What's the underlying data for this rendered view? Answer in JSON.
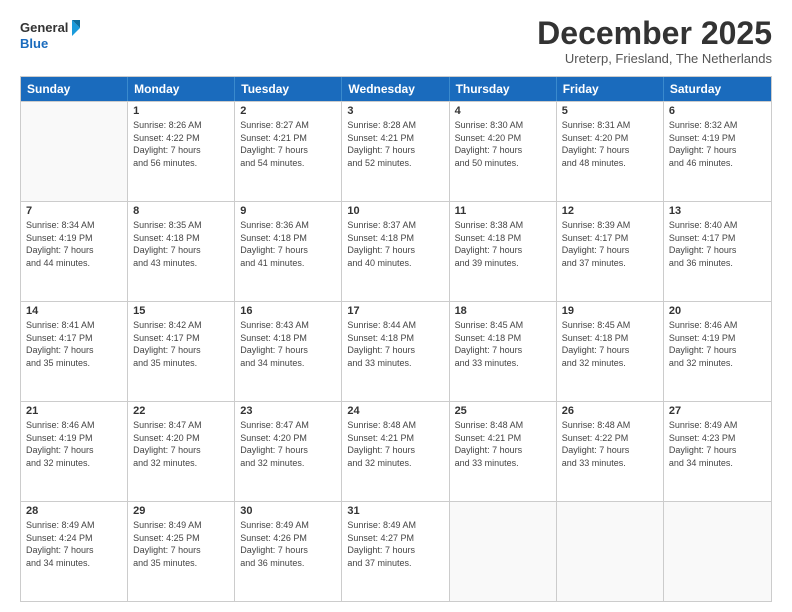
{
  "logo": {
    "line1": "General",
    "line2": "Blue"
  },
  "title": "December 2025",
  "subtitle": "Ureterp, Friesland, The Netherlands",
  "days_of_week": [
    "Sunday",
    "Monday",
    "Tuesday",
    "Wednesday",
    "Thursday",
    "Friday",
    "Saturday"
  ],
  "weeks": [
    [
      {
        "day": "",
        "info": ""
      },
      {
        "day": "1",
        "info": "Sunrise: 8:26 AM\nSunset: 4:22 PM\nDaylight: 7 hours\nand 56 minutes."
      },
      {
        "day": "2",
        "info": "Sunrise: 8:27 AM\nSunset: 4:21 PM\nDaylight: 7 hours\nand 54 minutes."
      },
      {
        "day": "3",
        "info": "Sunrise: 8:28 AM\nSunset: 4:21 PM\nDaylight: 7 hours\nand 52 minutes."
      },
      {
        "day": "4",
        "info": "Sunrise: 8:30 AM\nSunset: 4:20 PM\nDaylight: 7 hours\nand 50 minutes."
      },
      {
        "day": "5",
        "info": "Sunrise: 8:31 AM\nSunset: 4:20 PM\nDaylight: 7 hours\nand 48 minutes."
      },
      {
        "day": "6",
        "info": "Sunrise: 8:32 AM\nSunset: 4:19 PM\nDaylight: 7 hours\nand 46 minutes."
      }
    ],
    [
      {
        "day": "7",
        "info": "Sunrise: 8:34 AM\nSunset: 4:19 PM\nDaylight: 7 hours\nand 44 minutes."
      },
      {
        "day": "8",
        "info": "Sunrise: 8:35 AM\nSunset: 4:18 PM\nDaylight: 7 hours\nand 43 minutes."
      },
      {
        "day": "9",
        "info": "Sunrise: 8:36 AM\nSunset: 4:18 PM\nDaylight: 7 hours\nand 41 minutes."
      },
      {
        "day": "10",
        "info": "Sunrise: 8:37 AM\nSunset: 4:18 PM\nDaylight: 7 hours\nand 40 minutes."
      },
      {
        "day": "11",
        "info": "Sunrise: 8:38 AM\nSunset: 4:18 PM\nDaylight: 7 hours\nand 39 minutes."
      },
      {
        "day": "12",
        "info": "Sunrise: 8:39 AM\nSunset: 4:17 PM\nDaylight: 7 hours\nand 37 minutes."
      },
      {
        "day": "13",
        "info": "Sunrise: 8:40 AM\nSunset: 4:17 PM\nDaylight: 7 hours\nand 36 minutes."
      }
    ],
    [
      {
        "day": "14",
        "info": "Sunrise: 8:41 AM\nSunset: 4:17 PM\nDaylight: 7 hours\nand 35 minutes."
      },
      {
        "day": "15",
        "info": "Sunrise: 8:42 AM\nSunset: 4:17 PM\nDaylight: 7 hours\nand 35 minutes."
      },
      {
        "day": "16",
        "info": "Sunrise: 8:43 AM\nSunset: 4:18 PM\nDaylight: 7 hours\nand 34 minutes."
      },
      {
        "day": "17",
        "info": "Sunrise: 8:44 AM\nSunset: 4:18 PM\nDaylight: 7 hours\nand 33 minutes."
      },
      {
        "day": "18",
        "info": "Sunrise: 8:45 AM\nSunset: 4:18 PM\nDaylight: 7 hours\nand 33 minutes."
      },
      {
        "day": "19",
        "info": "Sunrise: 8:45 AM\nSunset: 4:18 PM\nDaylight: 7 hours\nand 32 minutes."
      },
      {
        "day": "20",
        "info": "Sunrise: 8:46 AM\nSunset: 4:19 PM\nDaylight: 7 hours\nand 32 minutes."
      }
    ],
    [
      {
        "day": "21",
        "info": "Sunrise: 8:46 AM\nSunset: 4:19 PM\nDaylight: 7 hours\nand 32 minutes."
      },
      {
        "day": "22",
        "info": "Sunrise: 8:47 AM\nSunset: 4:20 PM\nDaylight: 7 hours\nand 32 minutes."
      },
      {
        "day": "23",
        "info": "Sunrise: 8:47 AM\nSunset: 4:20 PM\nDaylight: 7 hours\nand 32 minutes."
      },
      {
        "day": "24",
        "info": "Sunrise: 8:48 AM\nSunset: 4:21 PM\nDaylight: 7 hours\nand 32 minutes."
      },
      {
        "day": "25",
        "info": "Sunrise: 8:48 AM\nSunset: 4:21 PM\nDaylight: 7 hours\nand 33 minutes."
      },
      {
        "day": "26",
        "info": "Sunrise: 8:48 AM\nSunset: 4:22 PM\nDaylight: 7 hours\nand 33 minutes."
      },
      {
        "day": "27",
        "info": "Sunrise: 8:49 AM\nSunset: 4:23 PM\nDaylight: 7 hours\nand 34 minutes."
      }
    ],
    [
      {
        "day": "28",
        "info": "Sunrise: 8:49 AM\nSunset: 4:24 PM\nDaylight: 7 hours\nand 34 minutes."
      },
      {
        "day": "29",
        "info": "Sunrise: 8:49 AM\nSunset: 4:25 PM\nDaylight: 7 hours\nand 35 minutes."
      },
      {
        "day": "30",
        "info": "Sunrise: 8:49 AM\nSunset: 4:26 PM\nDaylight: 7 hours\nand 36 minutes."
      },
      {
        "day": "31",
        "info": "Sunrise: 8:49 AM\nSunset: 4:27 PM\nDaylight: 7 hours\nand 37 minutes."
      },
      {
        "day": "",
        "info": ""
      },
      {
        "day": "",
        "info": ""
      },
      {
        "day": "",
        "info": ""
      }
    ]
  ]
}
